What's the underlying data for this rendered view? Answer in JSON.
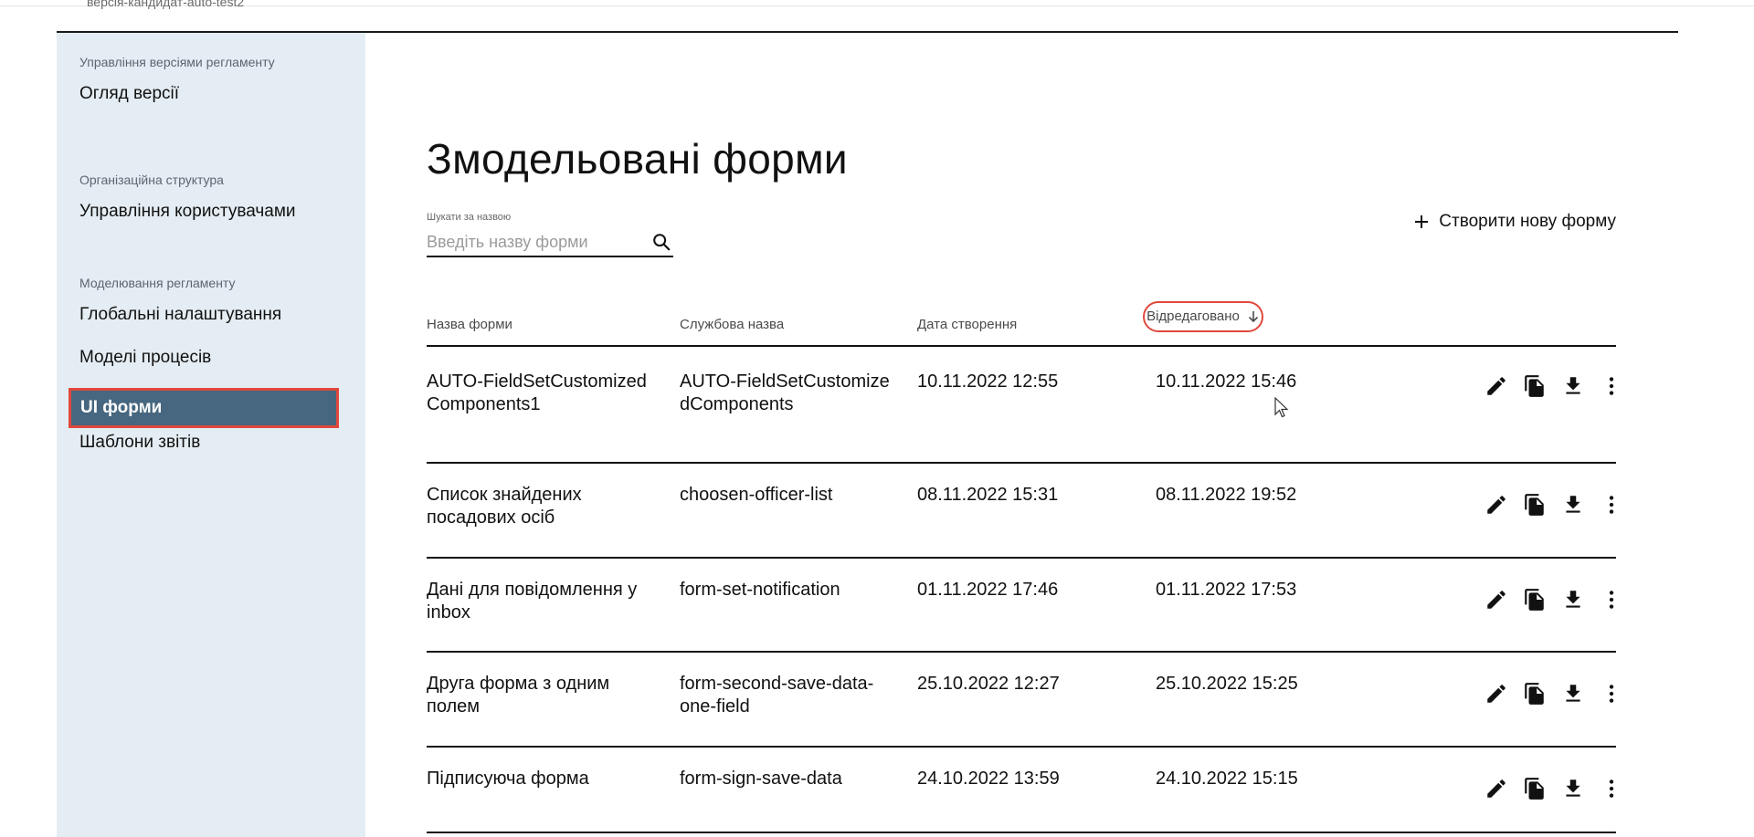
{
  "header": {
    "version_label": "версія-кандидат-auto-test2"
  },
  "sidebar": {
    "sections": [
      {
        "title": "Управління версіями регламенту",
        "items": [
          {
            "label": "Огляд версії"
          }
        ]
      },
      {
        "title": "Організаційна структура",
        "items": [
          {
            "label": "Управління користувачами"
          }
        ]
      },
      {
        "title": "Моделювання регламенту",
        "items": [
          {
            "label": "Глобальні налаштування"
          },
          {
            "label": "Моделі процесів"
          },
          {
            "label": "UI форми",
            "active": true
          },
          {
            "label": "Шаблони звітів"
          }
        ]
      }
    ]
  },
  "main": {
    "title": "Змодельовані форми",
    "search": {
      "label": "Шукати за назвою",
      "placeholder": "Введіть назву форми",
      "value": ""
    },
    "create_button": "Створити нову форму",
    "columns": {
      "name": "Назва форми",
      "service_name": "Службова назва",
      "created": "Дата створення",
      "edited": "Відредаговано"
    },
    "sort": {
      "column": "edited",
      "direction": "descending"
    },
    "rows": [
      {
        "name": "AUTO-FieldSetCustomizedComponents1",
        "service_name": "AUTO-FieldSetCustomizedComponents",
        "created": "10.11.2022 12:55",
        "edited": "10.11.2022 15:46"
      },
      {
        "name": "Список знайдених посадових осіб",
        "service_name": "choosen-officer-list",
        "created": "08.11.2022 15:31",
        "edited": "08.11.2022 19:52"
      },
      {
        "name": "Дані для повідомлення у inbox",
        "service_name": "form-set-notification",
        "created": "01.11.2022 17:46",
        "edited": "01.11.2022 17:53"
      },
      {
        "name": "Друга форма з одним полем",
        "service_name": "form-second-save-data-one-field",
        "created": "25.10.2022 12:27",
        "edited": "25.10.2022 15:25"
      },
      {
        "name": "Підписуюча форма",
        "service_name": "form-sign-save-data",
        "created": "24.10.2022 13:59",
        "edited": "24.10.2022 15:15"
      }
    ],
    "row_actions": [
      "edit-icon",
      "copy-icon",
      "download-icon",
      "more-vert-icon"
    ]
  },
  "colors": {
    "sidebar_bg": "#e4edf3",
    "active_item_bg": "#46677f",
    "highlight": "#e0483c"
  }
}
